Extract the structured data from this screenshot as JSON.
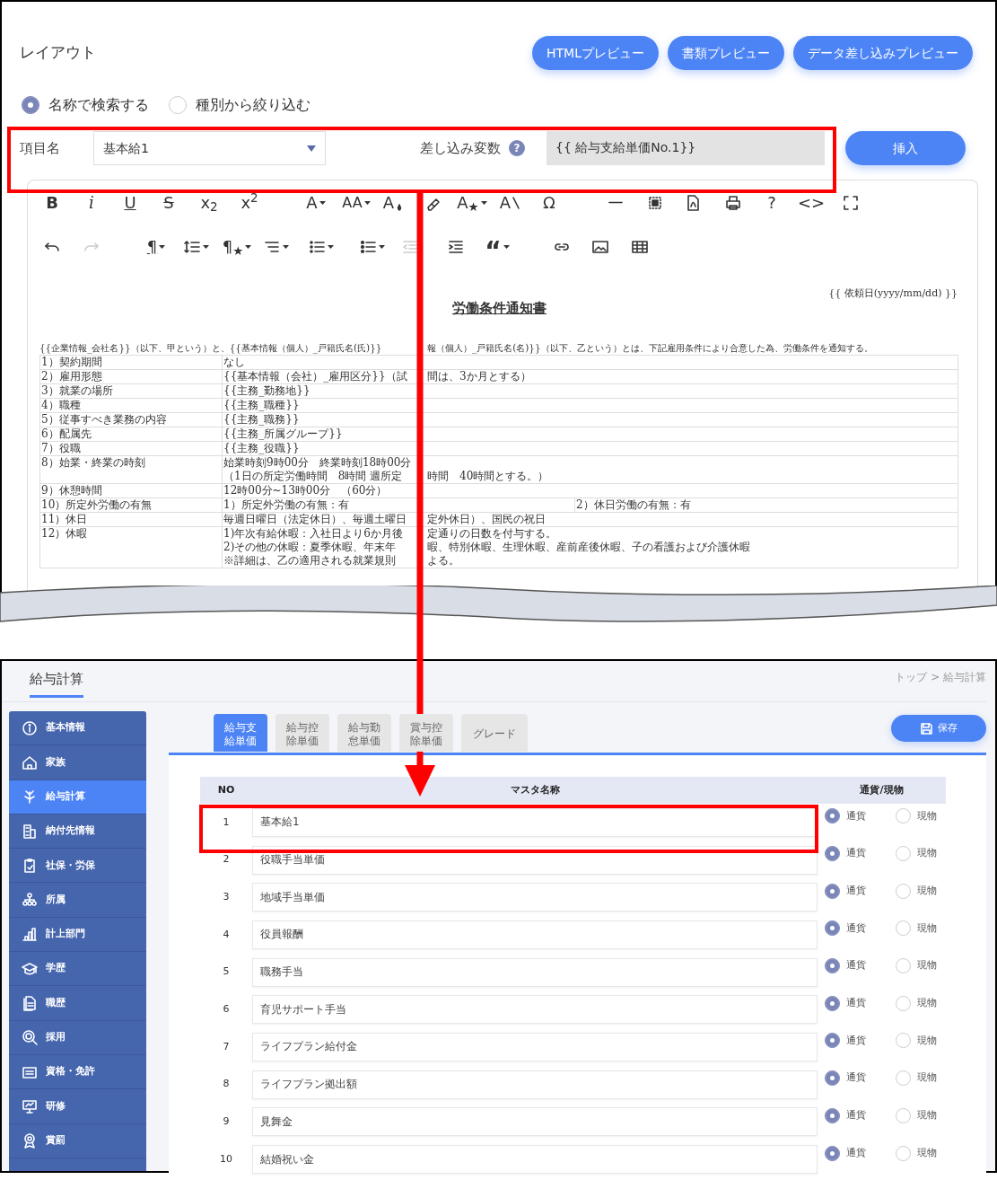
{
  "layout_panel": {
    "title": "レイアウト",
    "preview_buttons": [
      "HTMLプレビュー",
      "書類プレビュー",
      "データ差し込みプレビュー"
    ],
    "search_modes": [
      {
        "label": "名称で検索する",
        "selected": true
      },
      {
        "label": "種別から絞り込む",
        "selected": false
      }
    ],
    "item_label": "項目名",
    "item_select": "基本給1",
    "variable_label": "差し込み変数",
    "help": "?",
    "variable_value": "{{ 給与支給単価No.1}}",
    "insert_button": "挿入",
    "toolbar": [
      [
        {
          "kind": "glyph",
          "label": "B"
        },
        {
          "kind": "glyph",
          "label": "i"
        },
        {
          "kind": "glyph",
          "label": "U"
        },
        {
          "kind": "glyph",
          "label": "S"
        },
        {
          "kind": "glyph",
          "label": "x$_{2}$"
        },
        {
          "kind": "glyph",
          "label": "x$^{2}$"
        },
        {
          "kind": "glyph",
          "label": "A",
          "caret": true
        },
        {
          "kind": "glyph",
          "label": "AA",
          "caret": true
        },
        {
          "kind": "glyph",
          "label": "A"
        },
        {
          "kind": "icon"
        },
        {
          "kind": "glyph",
          "label": "A$_{★}$",
          "caret": true
        },
        {
          "kind": "glyph",
          "label": "A"
        },
        {
          "kind": "glyph",
          "label": "Ω"
        },
        {
          "kind": "icon"
        },
        {
          "kind": "icon"
        },
        {
          "kind": "icon"
        },
        {
          "kind": "icon"
        },
        {
          "kind": "glyph",
          "label": "?"
        },
        {
          "kind": "glyph",
          "label": "<>"
        },
        {
          "kind": "icon"
        }
      ],
      [
        {
          "kind": "icon"
        },
        {
          "kind": "icon",
          "disabled": true
        },
        {
          "kind": "glyph",
          "label": "¶",
          "caret": true
        },
        {
          "kind": "icon",
          "caret": true
        },
        {
          "kind": "glyph",
          "label": "¶$_{★}$",
          "caret": true
        },
        {
          "kind": "icon",
          "caret": true
        },
        {
          "kind": "icon",
          "caret": true
        },
        {
          "kind": "icon",
          "caret": true
        },
        {
          "kind": "icon",
          "disabled": true
        },
        {
          "kind": "icon"
        },
        {
          "kind": "glyph",
          "label": "“",
          "caret": true
        },
        {
          "kind": "icon"
        },
        {
          "kind": "icon"
        },
        {
          "kind": "icon"
        }
      ]
    ],
    "document": {
      "date": "{{ 依頼日(yyyy/mm/dd) }}",
      "title": "労働条件通知書",
      "intro": [
        "{{企業情報_会社名}}（以下、甲という）と、{{基本情報（個人）_戸籍氏名(氏)}}",
        "報（個人）_戸籍氏名(名)}}（以下、乙という）とは、下記雇用条件により合意した為、労働条件を通知する。"
      ],
      "rows": [
        {
          "cells": [
            [
              [
                "1）契約期間"
              ]
            ],
            [
              [
                "なし"
              ]
            ]
          ]
        },
        {
          "cells": [
            [
              [
                "2）雇用形態"
              ]
            ],
            [
              [
                "{{基本情報（会社）_雇用区分}}（試",
                "間は、3か月とする）"
              ]
            ]
          ]
        },
        {
          "cells": [
            [
              [
                "3）就業の場所"
              ]
            ],
            [
              [
                "{{主務_勤務地}}"
              ]
            ]
          ]
        },
        {
          "cells": [
            [
              [
                "4）職種"
              ]
            ],
            [
              [
                "{{主務_職種}}"
              ]
            ]
          ]
        },
        {
          "cells": [
            [
              [
                "5）従事すべき業務の内容"
              ]
            ],
            [
              [
                "{{主務_職務}}"
              ]
            ]
          ]
        },
        {
          "cells": [
            [
              [
                "6）配属先"
              ]
            ],
            [
              [
                "{{主務_所属グループ}}"
              ]
            ]
          ]
        },
        {
          "cells": [
            [
              [
                "7）役職"
              ]
            ],
            [
              [
                "{{主務_役職}}"
              ]
            ]
          ]
        },
        {
          "cells": [
            [
              [
                "8）始業・終業の時刻"
              ]
            ],
            [
              [
                "始業時刻9時00分　終業時刻18時00分"
              ],
              [
                "（1日の所定労働時間　8時間 週所定",
                "時間　40時間とする。）"
              ]
            ]
          ]
        },
        {
          "cells": [
            [
              [
                "9）休憩時間"
              ]
            ],
            [
              [
                "12時00分~13時00分　（60分）"
              ]
            ]
          ]
        },
        {
          "cells": [
            [
              [
                "10）所定外労働の有無"
              ]
            ],
            [
              [
                "1）所定外労働の有無：有"
              ]
            ],
            [
              [
                "2）休日労働の有無：有"
              ]
            ]
          ]
        },
        {
          "cells": [
            [
              [
                "11）休日"
              ]
            ],
            [
              [
                "毎週日曜日（法定休日）、毎週土曜日",
                "定外休日）、国民の祝日"
              ]
            ]
          ]
        },
        {
          "cells": [
            [
              [
                "12）休暇"
              ]
            ],
            [
              [
                "1)年次有給休暇：入社日より6か月後",
                "定通りの日数を付与する。"
              ],
              [
                "2)その他の休暇：夏季休暇、年末年",
                "暇、特別休暇、生理休暇、産前産後休暇、子の看護および介護休暇"
              ],
              [
                "※詳細は、乙の適用される就業規則",
                "よる。"
              ]
            ]
          ]
        }
      ]
    }
  },
  "payroll_panel": {
    "title": "給与計算",
    "breadcrumb": "トップ > 給与計算",
    "sidebar": [
      {
        "label": "基本情報",
        "selected": false
      },
      {
        "label": "家族",
        "selected": false
      },
      {
        "label": "給与計算",
        "selected": true
      },
      {
        "label": "納付先情報",
        "selected": false
      },
      {
        "label": "社保・労保",
        "selected": false
      },
      {
        "label": "所属",
        "selected": false
      },
      {
        "label": "計上部門",
        "selected": false
      },
      {
        "label": "学歴",
        "selected": false
      },
      {
        "label": "職歴",
        "selected": false
      },
      {
        "label": "採用",
        "selected": false
      },
      {
        "label": "資格・免許",
        "selected": false
      },
      {
        "label": "研修",
        "selected": false
      },
      {
        "label": "賞罰",
        "selected": false
      }
    ],
    "tabs": [
      {
        "label": "給与支給単価",
        "selected": true
      },
      {
        "label": "給与控除単価",
        "selected": false
      },
      {
        "label": "給与勤怠単価",
        "selected": false
      },
      {
        "label": "賞与控除単価",
        "selected": false
      },
      {
        "label": "グレード",
        "selected": false
      }
    ],
    "save_button": "保存",
    "table": {
      "columns": [
        "NO",
        "マスタ名称",
        "通貨/現物"
      ],
      "rows": [
        {
          "no": "1",
          "name": "基本給1",
          "options": [
            {
              "label": "通貨",
              "selected": true
            },
            {
              "label": "現物",
              "selected": false
            }
          ]
        },
        {
          "no": "2",
          "name": "役職手当単価",
          "options": [
            {
              "label": "通貨",
              "selected": true
            },
            {
              "label": "現物",
              "selected": false
            }
          ]
        },
        {
          "no": "3",
          "name": "地域手当単価",
          "options": [
            {
              "label": "通貨",
              "selected": true
            },
            {
              "label": "現物",
              "selected": false
            }
          ]
        },
        {
          "no": "4",
          "name": "役員報酬",
          "options": [
            {
              "label": "通貨",
              "selected": true
            },
            {
              "label": "現物",
              "selected": false
            }
          ]
        },
        {
          "no": "5",
          "name": "職務手当",
          "options": [
            {
              "label": "通貨",
              "selected": true
            },
            {
              "label": "現物",
              "selected": false
            }
          ]
        },
        {
          "no": "6",
          "name": "育児サポート手当",
          "options": [
            {
              "label": "通貨",
              "selected": true
            },
            {
              "label": "現物",
              "selected": false
            }
          ]
        },
        {
          "no": "7",
          "name": "ライフプラン給付金",
          "options": [
            {
              "label": "通貨",
              "selected": true
            },
            {
              "label": "現物",
              "selected": false
            }
          ]
        },
        {
          "no": "8",
          "name": "ライフプラン拠出額",
          "options": [
            {
              "label": "通貨",
              "selected": true
            },
            {
              "label": "現物",
              "selected": false
            }
          ]
        },
        {
          "no": "9",
          "name": "見舞金",
          "options": [
            {
              "label": "通貨",
              "selected": true
            },
            {
              "label": "現物",
              "selected": false
            }
          ]
        },
        {
          "no": "10",
          "name": "結婚祝い金",
          "options": [
            {
              "label": "通貨",
              "selected": true
            },
            {
              "label": "現物",
              "selected": false
            }
          ]
        }
      ]
    }
  }
}
